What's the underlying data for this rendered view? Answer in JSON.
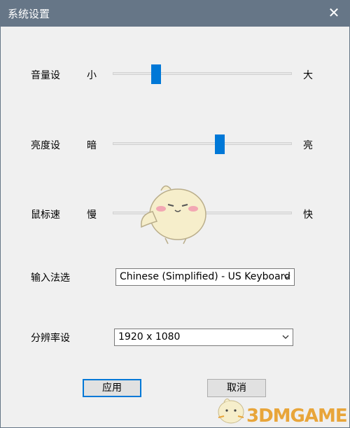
{
  "window": {
    "title": "系统设置",
    "close_label": "✕"
  },
  "settings": {
    "volume": {
      "label": "音量设",
      "min_label": "小",
      "max_label": "大",
      "level": 0.24
    },
    "brightness": {
      "label": "亮度设",
      "min_label": "暗",
      "max_label": "亮",
      "level": 0.6
    },
    "mouse_speed": {
      "label": "鼠标速",
      "min_label": "慢",
      "max_label": "快",
      "level": 0.47
    },
    "input_method": {
      "label": "输入法选",
      "selected": "Chinese (Simplified) - US Keyboard"
    },
    "resolution": {
      "label": "分辨率设",
      "selected": "1920 x 1080"
    }
  },
  "buttons": {
    "apply_label": "应用",
    "cancel_label": "取消"
  },
  "watermark": {
    "text": "3DMGAME"
  },
  "colors": {
    "titlebar": "#667687",
    "accent": "#0078d7",
    "watermark": "#e8a53a"
  }
}
